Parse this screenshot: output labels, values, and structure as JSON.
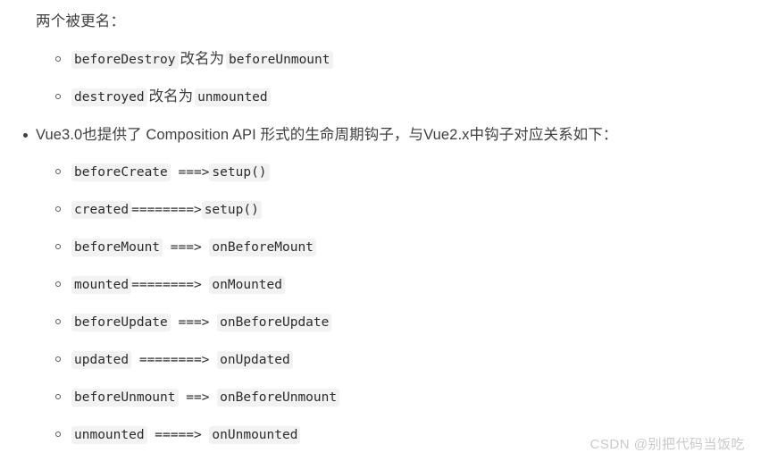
{
  "intro": {
    "text": "两个被更名："
  },
  "renamed_items": [
    {
      "code_before": "beforeDestroy",
      "middle": "改名为",
      "code_after": "beforeUnmount"
    },
    {
      "code_before": "destroyed",
      "middle": "改名为",
      "code_after": "unmounted"
    }
  ],
  "main_bullet": {
    "text": "Vue3.0也提供了 Composition API 形式的生命周期钩子，与Vue2.x中钩子对应关系如下："
  },
  "mapping_items": [
    {
      "code_before": "beforeCreate",
      "arrow": " ===>",
      "code_after": "setup()"
    },
    {
      "code_before": "created",
      "arrow": "========>",
      "code_after": "setup()"
    },
    {
      "code_before": "beforeMount",
      "arrow": " ===> ",
      "code_after": "onBeforeMount"
    },
    {
      "code_before": "mounted",
      "arrow": "========> ",
      "code_after": "onMounted"
    },
    {
      "code_before": "beforeUpdate",
      "arrow": " ===> ",
      "code_after": "onBeforeUpdate"
    },
    {
      "code_before": "updated",
      "arrow": " ========> ",
      "code_after": "onUpdated"
    },
    {
      "code_before": "beforeUnmount",
      "arrow": " ==> ",
      "code_after": "onBeforeUnmount"
    },
    {
      "code_before": "unmounted",
      "arrow": " =====> ",
      "code_after": "onUnmounted"
    }
  ],
  "watermark": {
    "text": "CSDN @别把代码当饭吃"
  },
  "colors": {
    "text": "#3f3f3f",
    "code_bg": "#f2f2f2",
    "code_text": "#2b2b2b",
    "watermark": "#c9c9c9"
  }
}
